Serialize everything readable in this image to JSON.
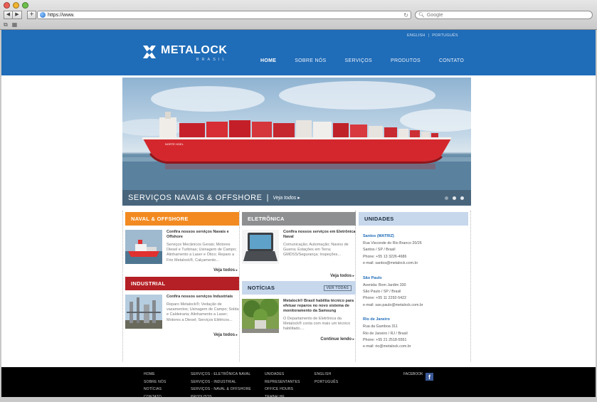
{
  "browser": {
    "url": "https://www.",
    "search_placeholder": "Google"
  },
  "header": {
    "lang_english": "ENGLISH",
    "lang_portuguese": "PORTUGUÊS",
    "lang_separator": "|",
    "logo_name": "METALOCK",
    "logo_sub": "BRASIL",
    "nav": [
      {
        "label": "HOME"
      },
      {
        "label": "SOBRE NÓS"
      },
      {
        "label": "SERVIÇOS"
      },
      {
        "label": "PRODUTOS"
      },
      {
        "label": "CONTATO"
      }
    ],
    "colors": {
      "brand": "#1f6cb8"
    }
  },
  "hero": {
    "title": "SERVIÇOS NAVAIS & OFFSHORE",
    "separator": "|",
    "link": "Veja todos",
    "ship_name": "NORTE HOEL",
    "slides": 3
  },
  "naval": {
    "heading": "NAVAL & OFFSHORE",
    "title": "Confira nossos serviços Navais e Offshore",
    "body": "Serviços Mecânicos Gerais; Motores Diesel e Turbinas; Usinagem de Campo; Alinhamento a Laser e Ótico; Reparo a Frio Metalock®, Calçamento...",
    "see_all": "Veja todos"
  },
  "eletronica": {
    "heading": "ELETRÔNICA",
    "title": "Confira nossos serviços em Eletrônica Naval",
    "body": "Comunicação; Automação; Navios de Guerra; Estações em Terra; GMDSS/Segurança; Inspeções...",
    "see_all": "Veja todos"
  },
  "industrial": {
    "heading": "INDUSTRIAL",
    "title": "Confira nossos serviços Industriais",
    "body": "Reparo Metalock®; Vedação de vazamentos; Usinagem de Campo; Solda e Caldeiraria; Alinhamento a Laser; Motores a Diesel; Serviços Elétricos...",
    "see_all": "Veja todos"
  },
  "noticias": {
    "heading": "NOTÍCIAS",
    "more": "VER TODAS",
    "title": "Metalock® Brasil habilita técnico para efetuar reparos no novo sistema de monitoramento da Samsung",
    "body": "O Departamento de Eletrônica da Metalock® conta com mais um técnico habilitado....",
    "link": "Continue lendo"
  },
  "unidades": {
    "heading": "UNIDADES",
    "units": [
      {
        "city": "Santos (MATRIZ)",
        "lines": [
          "Rua Visconde do Rio Branco 20/26",
          "Santos / SP / Brasil",
          "Phone: +55 13 3226-4686",
          "e-mail: santos@metalock.com.br"
        ]
      },
      {
        "city": "São Paulo",
        "lines": [
          "Avenida: Bom Jardim 330",
          "São Paulo / SP / Brasil",
          "Phone: +55 11 2292-5422",
          "e-mail: sao.paulo@metalock.com.br"
        ]
      },
      {
        "city": "Rio de Janeiro",
        "lines": [
          "Rua da Gamboa 311",
          "Rio de Janeiro / RJ / Brasil",
          "Phone: +55 21 2518-5551",
          "e-mail: rio@metalock.com.br"
        ]
      }
    ]
  },
  "footer": {
    "col1": [
      "HOME",
      "SOBRE NÓS",
      "NOTÍCIAS",
      "CONTATO"
    ],
    "col2": [
      "SERVIÇOS - ELETRÔNICA NAVAL",
      "SERVIÇOS - INDUSTRIAL",
      "SERVIÇOS - NAVAL & OFFSHORE",
      "PRODUTOS"
    ],
    "col3": [
      "UNIDADES",
      "REPRESENTANTES",
      "OFFICE HOURS",
      "TRABALHE"
    ],
    "col4": [
      "ENGLISH",
      "PORTUGUÊS"
    ],
    "facebook": "FACEBOOK"
  }
}
